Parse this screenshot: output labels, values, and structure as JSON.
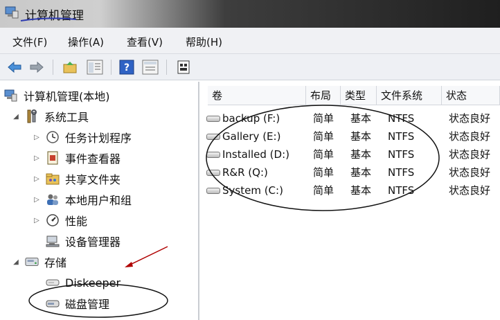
{
  "window": {
    "title": "计算机管理"
  },
  "menu": [
    "文件(F)",
    "操作(A)",
    "查看(V)",
    "帮助(H)"
  ],
  "toolbar": {
    "buttons": [
      "back-arrow-icon",
      "forward-arrow-icon",
      "up-folder-icon",
      "show-hide-tree-icon",
      "help-icon",
      "properties-icon",
      "export-icon"
    ]
  },
  "tree": {
    "root": "计算机管理(本地)",
    "system_tools": {
      "label": "系统工具",
      "children": [
        "任务计划程序",
        "事件查看器",
        "共享文件夹",
        "本地用户和组",
        "性能",
        "设备管理器"
      ]
    },
    "storage": {
      "label": "存储",
      "children": [
        "Diskeeper",
        "磁盘管理"
      ]
    }
  },
  "table": {
    "columns": [
      "卷",
      "布局",
      "类型",
      "文件系统",
      "状态"
    ],
    "rows": [
      {
        "volume": "backup (F:)",
        "layout": "简单",
        "type": "基本",
        "fs": "NTFS",
        "status": "状态良好"
      },
      {
        "volume": "Gallery (E:)",
        "layout": "简单",
        "type": "基本",
        "fs": "NTFS",
        "status": "状态良好"
      },
      {
        "volume": "Installed (D:)",
        "layout": "简单",
        "type": "基本",
        "fs": "NTFS",
        "status": "状态良好"
      },
      {
        "volume": "R&R (Q:)",
        "layout": "简单",
        "type": "基本",
        "fs": "NTFS",
        "status": "状态良好"
      },
      {
        "volume": "System (C:)",
        "layout": "简单",
        "type": "基本",
        "fs": "NTFS",
        "status": "状态良好"
      }
    ]
  },
  "colors": {
    "annotation": "#b00000",
    "tree_bg": "#ffffff",
    "header_bg": "#f7f8fa"
  }
}
